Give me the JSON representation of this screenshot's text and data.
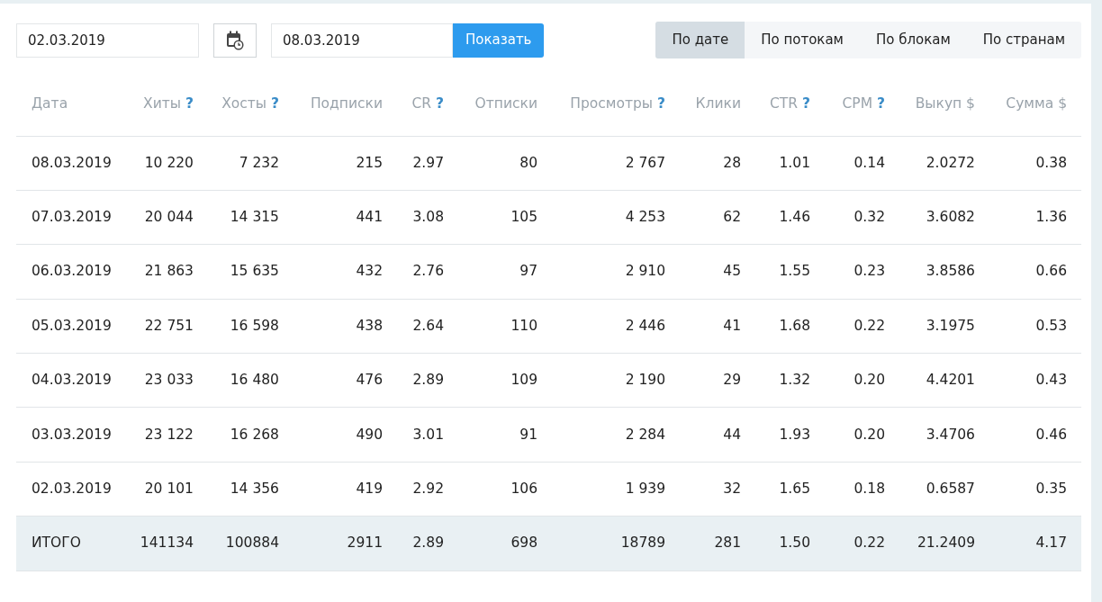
{
  "filter": {
    "date_from": "02.03.2019",
    "date_to": "08.03.2019",
    "submit": "Показать"
  },
  "tabs": [
    {
      "label": "По дате",
      "selected": true
    },
    {
      "label": "По потокам",
      "selected": false
    },
    {
      "label": "По блокам",
      "selected": false
    },
    {
      "label": "По странам",
      "selected": false
    }
  ],
  "table": {
    "columns": [
      {
        "label": "Дата"
      },
      {
        "label": "Хиты",
        "help": "?"
      },
      {
        "label": "Хосты",
        "help": "?"
      },
      {
        "label": "Подписки"
      },
      {
        "label": "CR",
        "help": "?"
      },
      {
        "label": "Отписки"
      },
      {
        "label": "Просмотры",
        "help": "?"
      },
      {
        "label": "Клики"
      },
      {
        "label": "CTR",
        "help": "?"
      },
      {
        "label": "CPM",
        "help": "?"
      },
      {
        "label": "Выкуп $"
      },
      {
        "label": "Сумма $"
      }
    ],
    "rows": [
      {
        "kind": "day",
        "cells": [
          "08.03.2019",
          "10 220",
          "7 232",
          "215",
          "2.97",
          "80",
          "2 767",
          "28",
          "1.01",
          "0.14",
          "2.0272",
          "0.38"
        ]
      },
      {
        "kind": "day",
        "cells": [
          "07.03.2019",
          "20 044",
          "14 315",
          "441",
          "3.08",
          "105",
          "4 253",
          "62",
          "1.46",
          "0.32",
          "3.6082",
          "1.36"
        ]
      },
      {
        "kind": "day",
        "cells": [
          "06.03.2019",
          "21 863",
          "15 635",
          "432",
          "2.76",
          "97",
          "2 910",
          "45",
          "1.55",
          "0.23",
          "3.8586",
          "0.66"
        ]
      },
      {
        "kind": "day",
        "cells": [
          "05.03.2019",
          "22 751",
          "16 598",
          "438",
          "2.64",
          "110",
          "2 446",
          "41",
          "1.68",
          "0.22",
          "3.1975",
          "0.53"
        ]
      },
      {
        "kind": "day",
        "cells": [
          "04.03.2019",
          "23 033",
          "16 480",
          "476",
          "2.89",
          "109",
          "2 190",
          "29",
          "1.32",
          "0.20",
          "4.4201",
          "0.43"
        ]
      },
      {
        "kind": "day",
        "cells": [
          "03.03.2019",
          "23 122",
          "16 268",
          "490",
          "3.01",
          "91",
          "2 284",
          "44",
          "1.93",
          "0.20",
          "3.4706",
          "0.46"
        ]
      },
      {
        "kind": "day",
        "cells": [
          "02.03.2019",
          "20 101",
          "14 356",
          "419",
          "2.92",
          "106",
          "1 939",
          "32",
          "1.65",
          "0.18",
          "0.6587",
          "0.35"
        ]
      },
      {
        "kind": "total",
        "cells": [
          "ИТОГО",
          "141134",
          "100884",
          "2911",
          "2.89",
          "698",
          "18789",
          "281",
          "1.50",
          "0.22",
          "21.2409",
          "4.17"
        ]
      }
    ]
  }
}
